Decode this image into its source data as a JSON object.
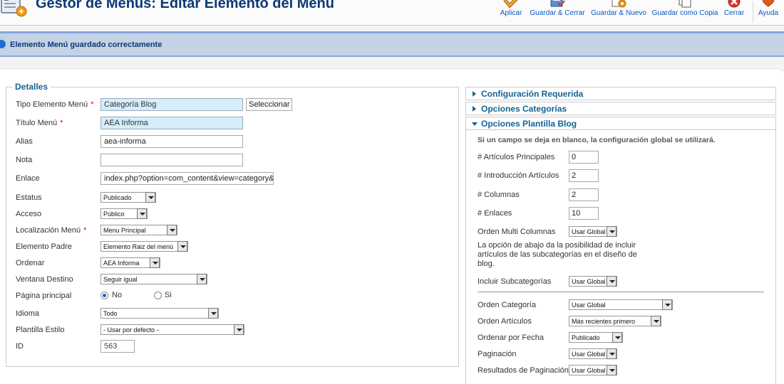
{
  "header": {
    "title": "Gestor de Menus: Editar Elemento del Menu",
    "toolbar": [
      {
        "label": "Aplicar",
        "icon": "apply-icon"
      },
      {
        "label": "Guardar & Cerrar",
        "icon": "save-close-icon"
      },
      {
        "label": "Guardar & Nuevo",
        "icon": "save-new-icon"
      },
      {
        "label": "Guardar como Copia",
        "icon": "save-copy-icon"
      },
      {
        "label": "Cerrar",
        "icon": "close-icon"
      },
      {
        "label": "Ayuda",
        "icon": "help-icon"
      }
    ]
  },
  "message": "Elemento Menú guardado correctamente",
  "details": {
    "legend": "Detalles",
    "tipo_label": "Tipo Elemento Menú",
    "tipo_value": "Categoría Blog",
    "tipo_button": "Seleccionar",
    "titulo_label": "Título Menú",
    "titulo_value": "AEA Informa",
    "alias_label": "Alias",
    "alias_value": "aea-informa",
    "nota_label": "Nota",
    "nota_value": "",
    "enlace_label": "Enlace",
    "enlace_value": "index.php?option=com_content&view=category&layout=blog&id=",
    "estatus_label": "Estatus",
    "estatus_value": "Publicado",
    "acceso_label": "Acceso",
    "acceso_value": "Público",
    "localizacion_label": "Localización Menú",
    "localizacion_value": "Menu Principal",
    "padre_label": "Elemento Padre",
    "padre_value": "Elemento Raiz del menú",
    "ordenar_label": "Ordenar",
    "ordenar_value": "AEA Informa",
    "ventana_label": "Ventana Destino",
    "ventana_value": "Seguir igual",
    "principal_label": "Página principal",
    "principal_no": "No",
    "principal_si": "Si",
    "idioma_label": "Idioma",
    "idioma_value": "Todo",
    "plantilla_label": "Plantilla Estilo",
    "plantilla_value": "- Usar por defecto -",
    "id_label": "ID",
    "id_value": "563"
  },
  "accordion": {
    "config": "Configuración Requerida",
    "categorias": "Opciones Categorías",
    "blog": "Opciones Plantilla Blog"
  },
  "blog": {
    "note": "Si un campo se deja en blanco, la configuración global se utilizará.",
    "principales_label": "# Artículos Principales",
    "principales_value": "0",
    "introduccion_label": "# Introducción Artículos",
    "introduccion_value": "2",
    "columnas_label": "# Columnas",
    "columnas_value": "2",
    "enlaces_label": "# Enlaces",
    "enlaces_value": "10",
    "multicol_label": "Orden Multi Columnas",
    "multicol_value": "Usar Global",
    "para": "La opción de abajo da la posibilidad de incluir artículos de las subcategorías en el diseño de blog.",
    "subcat_label": "Incluir Subcategorías",
    "subcat_value": "Usar Global",
    "ordencat_label": "Orden Categoría",
    "ordencat_value": "Usar Global",
    "ordenart_label": "Orden Artículos",
    "ordenart_value": "Más recientes primero",
    "ordenfecha_label": "Ordenar por Fecha",
    "ordenfecha_value": "Publicado",
    "paginacion_label": "Paginación",
    "paginacion_value": "Usar Global",
    "resultados_label": "Resultados de Paginación",
    "resultados_value": "Usar Global"
  },
  "colors": {
    "title": "#0b3a74",
    "link": "#0b55c4",
    "message_bg": "#c3d2e5",
    "section": "#146295",
    "required_star": "#dd0000",
    "required_input_bg": "#d5eefa"
  }
}
